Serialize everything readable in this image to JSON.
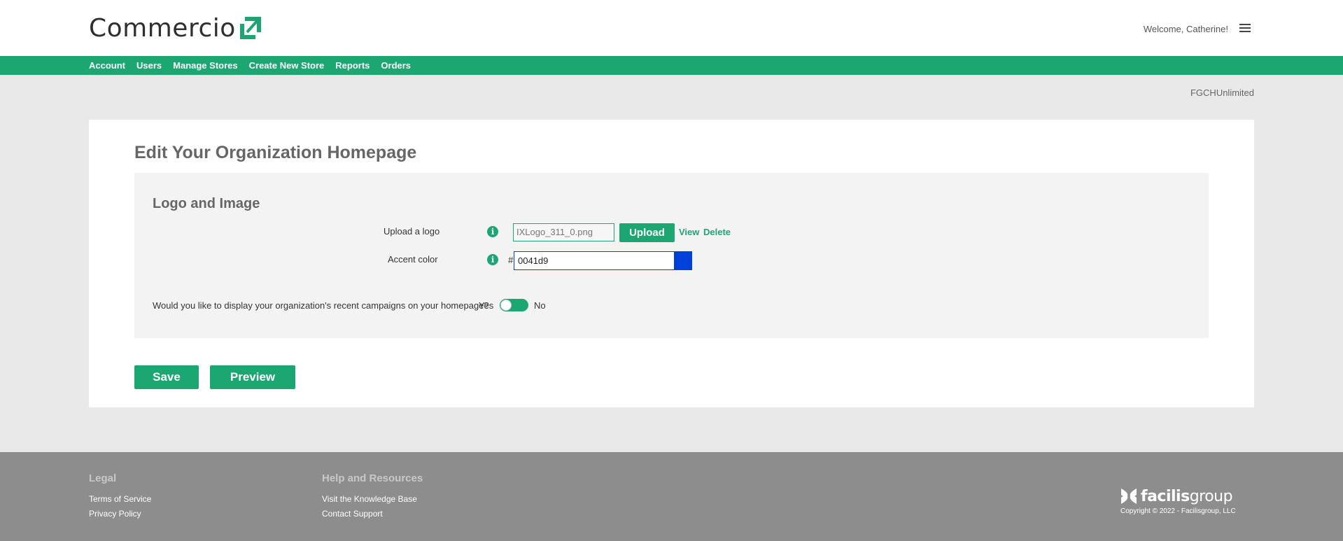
{
  "header": {
    "brand": "Commercio",
    "welcome": "Welcome, Catherine!"
  },
  "nav": {
    "items": [
      {
        "label": "Account"
      },
      {
        "label": "Users"
      },
      {
        "label": "Manage Stores"
      },
      {
        "label": "Create New Store"
      },
      {
        "label": "Reports"
      },
      {
        "label": "Orders"
      }
    ]
  },
  "org_name": "FGCHUnlimited",
  "main": {
    "title": "Edit Your Organization Homepage",
    "section_title": "Logo and Image",
    "logo_label": "Upload a logo",
    "logo_file": "IXLogo_311_0.png",
    "upload_label": "Upload",
    "view_label": "View",
    "delete_label": "Delete",
    "accent_label": "Accent color",
    "hash": "#",
    "accent_value": "0041d9",
    "accent_color": "#0041d9",
    "campaigns_question": "Would you like to display your organization's recent campaigns on your homepage?",
    "yes_label": "Yes",
    "no_label": "No",
    "save_label": "Save",
    "preview_label": "Preview"
  },
  "footer": {
    "legal_heading": "Legal",
    "terms": "Terms of Service",
    "privacy": "Privacy Policy",
    "help_heading": "Help and Resources",
    "knowledge": "Visit the Knowledge Base",
    "support": "Contact Support",
    "brand_bold": "facilis",
    "brand_light": "group",
    "copyright": "Copyright © 2022 - Facilisgroup, LLC"
  },
  "colors": {
    "brand_green": "#1ba672",
    "accent": "#0041d9"
  },
  "icons": [
    "menu-icon",
    "info-icon",
    "commercio-logo-mark",
    "facilisgroup-logo-mark"
  ]
}
